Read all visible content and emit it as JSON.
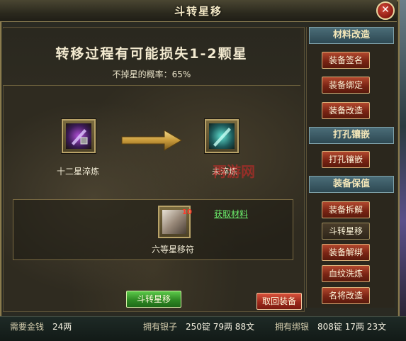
{
  "window": {
    "title": "斗转星移",
    "close_label": "✕"
  },
  "warning": {
    "title": "转移过程有可能损失1-2颗星",
    "rate_text": "不掉星的概率：65%"
  },
  "source_item": {
    "label": "十二星淬炼"
  },
  "target_item": {
    "label": "未淬炼"
  },
  "material": {
    "name": "六等星移符",
    "count": "10",
    "get_link": "获取材料"
  },
  "buttons": {
    "transfer": "斗转星移",
    "retrieve": "取回装备"
  },
  "sidebar": {
    "sections": [
      {
        "title": "材料改造",
        "items": [
          "装备签名",
          "装备绑定",
          "装备改造"
        ]
      },
      {
        "title": "打孔镶嵌",
        "items": [
          "打孔镶嵌"
        ]
      },
      {
        "title": "装备保值",
        "items": [
          "装备拆解",
          "斗转星移",
          "装备解绑",
          "血纹洗炼",
          "名将改造"
        ]
      }
    ],
    "active_item": "斗转星移"
  },
  "footer": {
    "gold_label": "需要金钱",
    "gold_value": "24两",
    "silver_label": "拥有银子",
    "silver_value": "250锭 79两 88文",
    "bound_label": "拥有绑银",
    "bound_value": "808锭 17两 23文"
  },
  "watermark": "再游网",
  "colors": {
    "accent_gold": "#b8a268",
    "green_button": "#2f8a24",
    "red_button": "#9e2a1c",
    "section_header": "#2d4852",
    "link_green": "#6cf06c"
  }
}
